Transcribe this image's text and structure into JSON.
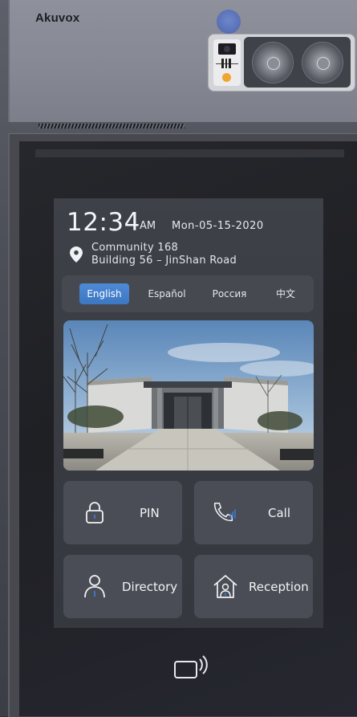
{
  "brand": "Akuvox",
  "clock": {
    "time": "12:34",
    "ampm": "AM",
    "date": "Mon-05-15-2020"
  },
  "location": {
    "line1": "Community 168",
    "line2": "Building 56 – JinShan Road"
  },
  "languages": [
    {
      "label": "English",
      "active": true
    },
    {
      "label": "Español",
      "active": false
    },
    {
      "label": "Россия",
      "active": false
    },
    {
      "label": "中文",
      "active": false
    }
  ],
  "tiles": {
    "pin": {
      "label": "PIN",
      "icon": "lock-icon"
    },
    "call": {
      "label": "Call",
      "icon": "phone-icon"
    },
    "directory": {
      "label": "Directory",
      "icon": "person-icon"
    },
    "reception": {
      "label": "Reception",
      "icon": "house-person-icon"
    }
  },
  "colors": {
    "accent": "#3d77c2",
    "screen_bg": "#3b3d45",
    "tile_bg": "#4b4d56",
    "led": "#f0a432"
  },
  "icons": {
    "location": "map-pin-icon",
    "card_reader": "nfc-card-icon",
    "sensor": "sensor-dot"
  }
}
